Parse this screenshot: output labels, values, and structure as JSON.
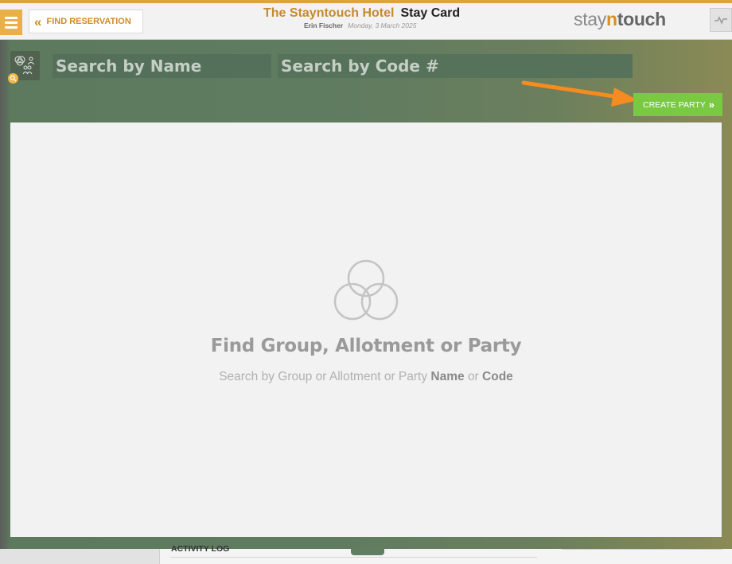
{
  "header": {
    "find_reservation_label": "FIND RESERVATION",
    "hotel_name": "The Stayntouch Hotel",
    "page_name": "Stay Card",
    "user_name": "Erin Fischer",
    "date": "Monday, 3 March 2025",
    "brand_part1": "stay",
    "brand_part2": "n",
    "brand_part3": "touch",
    "icons": {
      "menu": "hamburger-menu-icon",
      "back": "double-chevron-left-icon",
      "pulse": "pulse-line-icon"
    }
  },
  "search": {
    "name_placeholder": "Search by Name",
    "name_value": "",
    "code_placeholder": "Search by Code #",
    "code_value": "",
    "icons": {
      "group": "group-people-icon",
      "magnifier": "magnifier-icon"
    }
  },
  "actions": {
    "create_party_label": "CREATE PARTY",
    "create_party_icon": "double-chevron-right-icon"
  },
  "empty_state": {
    "icon": "three-circles-venn-icon",
    "title": "Find Group, Allotment or Party",
    "subtitle_prefix": "Search by Group or Allotment or Party",
    "subtitle_name": "Name",
    "subtitle_or": "or",
    "subtitle_code": "Code"
  },
  "footer": {
    "activity_log_label": "ACTIVITY LOG"
  },
  "colors": {
    "accent_orange": "#d18b22",
    "menu_orange": "#e9b048",
    "band_green": "#5f7b60",
    "create_green": "#7ac943",
    "annotation_arrow": "#f68b1f"
  }
}
